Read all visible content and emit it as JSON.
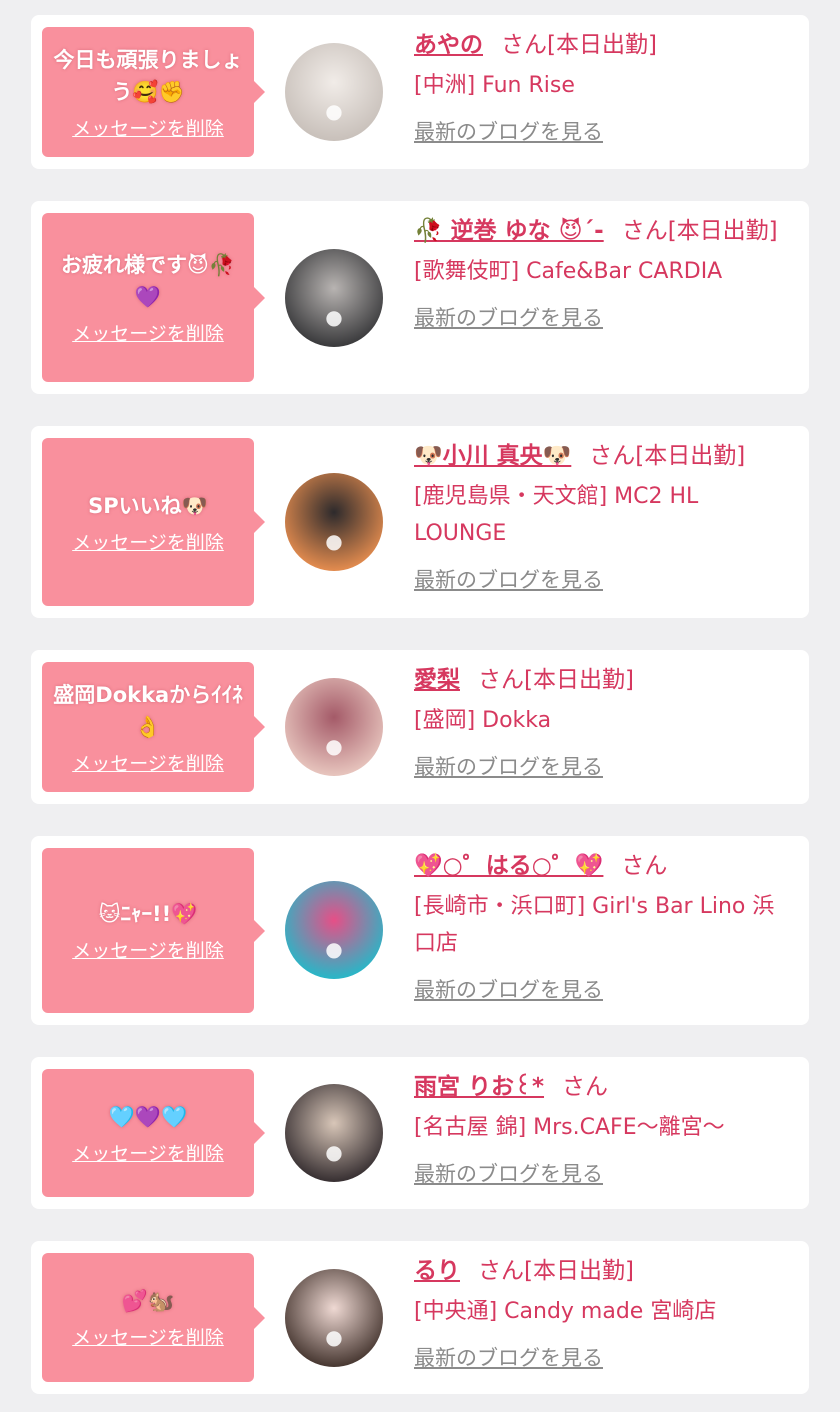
{
  "messages": [
    {
      "message": "今日も頑張りましょう🥰✊",
      "delete_label": "メッセージを削除",
      "name": "あやの",
      "suffix": "さん[本日出勤]",
      "shop": "[中洲] Fun Rise",
      "blog_label": "最新のブログを見る",
      "avatar_color_a": "#c9c1bb",
      "avatar_color_b": "#f1ece8"
    },
    {
      "message": "お疲れ様です😈🥀💜",
      "delete_label": "メッセージを削除",
      "name": "🥀 逆巻 ゆな 😈´-",
      "suffix": "さん[本日出勤]",
      "shop": "[歌舞伎町] Cafe&Bar CARDIA",
      "blog_label": "最新のブログを見る",
      "avatar_color_a": "#3c3c3e",
      "avatar_color_b": "#b8b4b2"
    },
    {
      "message": "SPいいね🐶",
      "delete_label": "メッセージを削除",
      "name": "🐶小川 真央🐶",
      "suffix": "さん[本日出勤]",
      "shop": "[鹿児島県・天文館] MC2 HL LOUNGE",
      "blog_label": "最新のブログを見る",
      "avatar_color_a": "#e08a4e",
      "avatar_color_b": "#2d2a2c"
    },
    {
      "message": "盛岡Dokkaからｲｲﾈ👌",
      "delete_label": "メッセージを削除",
      "name": "愛梨",
      "suffix": "さん[本日出勤]",
      "shop": "[盛岡] Dokka",
      "blog_label": "最新のブログを見る",
      "avatar_color_a": "#e6c3bc",
      "avatar_color_b": "#a45a68"
    },
    {
      "message": "🐱ﾆｬｰ!!💖",
      "delete_label": "メッセージを削除",
      "name": "💖○゜はる○゜💖",
      "suffix": "さん",
      "shop": "[長崎市・浜口町] Girl's Bar Lino 浜口店",
      "blog_label": "最新のブログを見る",
      "avatar_color_a": "#2bb5c6",
      "avatar_color_b": "#e64f87"
    },
    {
      "message": "🩵💜🩵",
      "delete_label": "メッセージを削除",
      "name": "雨宮 りお꒰*",
      "suffix": "さん",
      "shop": "[名古屋 錦] Mrs.CAFE〜離宮〜",
      "blog_label": "最新のブログを見る",
      "avatar_color_a": "#3a3234",
      "avatar_color_b": "#d8c6b8"
    },
    {
      "message": "💕🐿️",
      "delete_label": "メッセージを削除",
      "name": "るり",
      "suffix": "さん[本日出勤]",
      "shop": "[中央通] Candy made 宮崎店",
      "blog_label": "最新のブログを見る",
      "avatar_color_a": "#4a3a34",
      "avatar_color_b": "#efd9d3"
    }
  ]
}
